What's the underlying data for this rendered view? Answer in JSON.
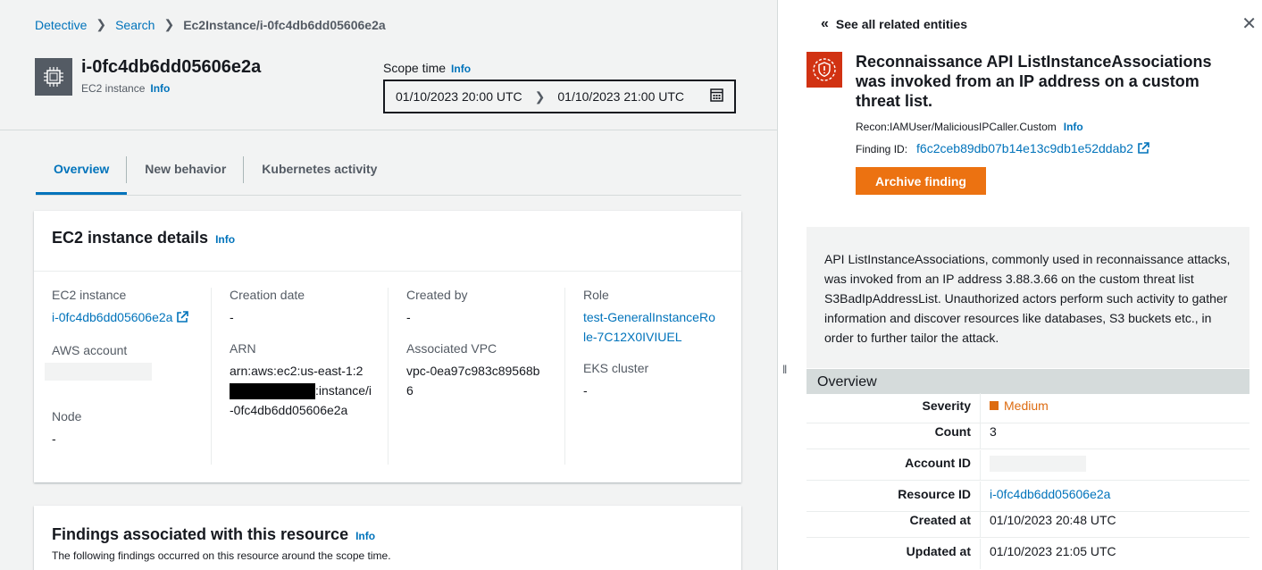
{
  "breadcrumb": {
    "items": [
      "Detective",
      "Search"
    ],
    "current": "Ec2Instance/i-0fc4db6dd05606e2a"
  },
  "resource": {
    "title": "i-0fc4db6dd05606e2a",
    "subtitle": "EC2 instance",
    "info": "Info"
  },
  "scope": {
    "label": "Scope time",
    "info": "Info",
    "start": "01/10/2023 20:00 UTC",
    "end": "01/10/2023 21:00 UTC"
  },
  "tabs": [
    {
      "label": "Overview",
      "active": true
    },
    {
      "label": "New behavior",
      "active": false
    },
    {
      "label": "Kubernetes activity",
      "active": false
    }
  ],
  "details": {
    "title": "EC2 instance details",
    "info": "Info",
    "ec2_instance_label": "EC2 instance",
    "ec2_instance_value": "i-0fc4db6dd05606e2a",
    "aws_account_label": "AWS account",
    "node_label": "Node",
    "node_value": "-",
    "creation_date_label": "Creation date",
    "creation_date_value": "-",
    "arn_label": "ARN",
    "arn_prefix": "arn:aws:ec2:us-east-1:2",
    "arn_suffix": ":instance/i-0fc4db6dd05606e2a",
    "created_by_label": "Created by",
    "created_by_value": "-",
    "vpc_label": "Associated VPC",
    "vpc_value": "vpc-0ea97c983c89568b6",
    "role_label": "Role",
    "role_value": "test-GeneralInstanceRole-7C12X0IVIUEL",
    "eks_label": "EKS cluster",
    "eks_value": "-"
  },
  "findings": {
    "title": "Findings associated with this resource",
    "info": "Info",
    "description": "The following findings occurred on this resource around the scope time."
  },
  "panel": {
    "see_all": "See all related entities",
    "finding_title": "Reconnaissance API ListInstanceAssociations was invoked from an IP address on a custom threat list.",
    "finding_type": "Recon:IAMUser/MaliciousIPCaller.Custom",
    "info": "Info",
    "finding_id_label": "Finding ID:",
    "finding_id": "f6c2ceb89db07b14e13c9db1e52ddab2",
    "archive_label": "Archive finding",
    "description": "API ListInstanceAssociations, commonly used in reconnaissance attacks, was invoked from an IP address 3.88.3.66 on the custom threat list S3BadIpAddressList. Unauthorized actors perform such activity to gather information and discover resources like databases, S3 buckets etc., in order to further tailor the attack.",
    "overview_label": "Overview",
    "overview": {
      "severity_label": "Severity",
      "severity_value": "Medium",
      "count_label": "Count",
      "count_value": "3",
      "account_label": "Account ID",
      "resource_label": "Resource ID",
      "resource_value": "i-0fc4db6dd05606e2a",
      "created_label": "Created at",
      "created_value": "01/10/2023 20:48 UTC",
      "updated_label": "Updated at",
      "updated_value": "01/10/2023 21:05 UTC"
    }
  },
  "colors": {
    "link": "#0073bb",
    "accent": "#ec7211",
    "severity_medium": "#dd6b10",
    "finding_icon": "#d13212"
  }
}
